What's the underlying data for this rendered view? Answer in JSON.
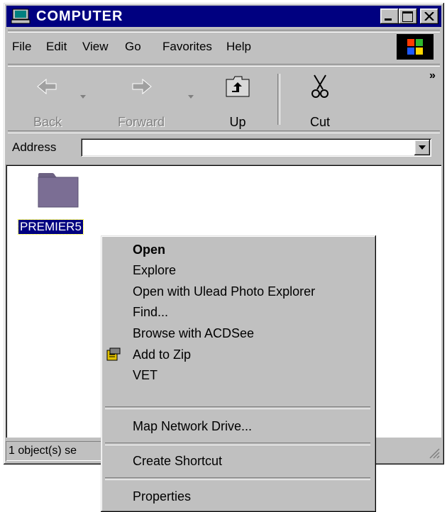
{
  "window": {
    "title": "COMPUTER"
  },
  "title_buttons": {
    "minimize": "_",
    "maximize": "□",
    "close": "×"
  },
  "menu": [
    {
      "label": "File"
    },
    {
      "label": "Edit"
    },
    {
      "label": "View"
    },
    {
      "label": "Go"
    },
    {
      "label": "Favorites"
    },
    {
      "label": "Help"
    }
  ],
  "toolbar": {
    "back": "Back",
    "forward": "Forward",
    "up": "Up",
    "cut": "Cut",
    "overflow": "»"
  },
  "address": {
    "label": "Address",
    "value": ""
  },
  "content": {
    "folder_label": "PREMIER5"
  },
  "status": {
    "text": "1 object(s) se"
  },
  "context_menu": {
    "open": "Open",
    "explore": "Explore",
    "open_with": "Open with Ulead Photo Explorer",
    "find": "Find...",
    "browse": "Browse with ACDSee",
    "add_zip": "Add to Zip",
    "vet": "VET",
    "map_drive": "Map Network Drive...",
    "create_shortcut": "Create Shortcut",
    "properties": "Properties"
  },
  "colors": {
    "titlebar": "#000080",
    "face": "#c0c0c0",
    "selection": "#000080",
    "folder": "#7b6e94"
  }
}
